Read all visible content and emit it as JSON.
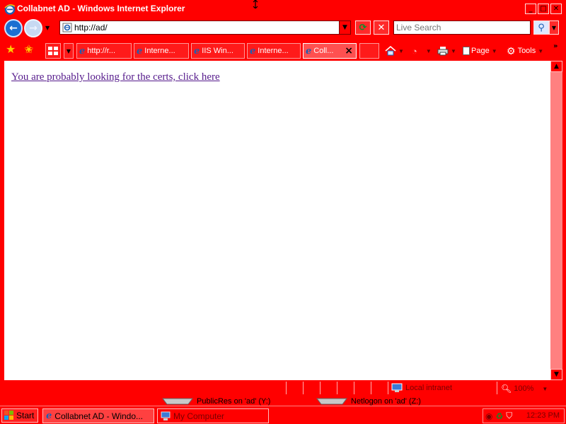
{
  "window": {
    "title": "Collabnet AD - Windows Internet Explorer"
  },
  "address": {
    "url": "http://ad/"
  },
  "search": {
    "placeholder": "Live Search"
  },
  "tabs": [
    {
      "label": "http://r..."
    },
    {
      "label": "Interne..."
    },
    {
      "label": "IIS Win..."
    },
    {
      "label": "Interne..."
    },
    {
      "label": "Coll..."
    }
  ],
  "command_bar": {
    "page_label": "Page",
    "tools_label": "Tools"
  },
  "content": {
    "link_text": "You are probably looking for the certs, click here"
  },
  "status": {
    "zone": "Local intranet",
    "zoom": "100%"
  },
  "desktop": {
    "drive1": "PublicRes on 'ad' (Y:)",
    "drive2": "Netlogon on 'ad' (Z:)"
  },
  "taskbar": {
    "start_label": "Start",
    "task1_label": "Collabnet AD - Windo...",
    "task2_label": "My Computer",
    "clock": "12:23 PM"
  },
  "colors": {
    "chrome": "#ff0000",
    "link": "#551a8b",
    "page_background": "#ffffff"
  }
}
